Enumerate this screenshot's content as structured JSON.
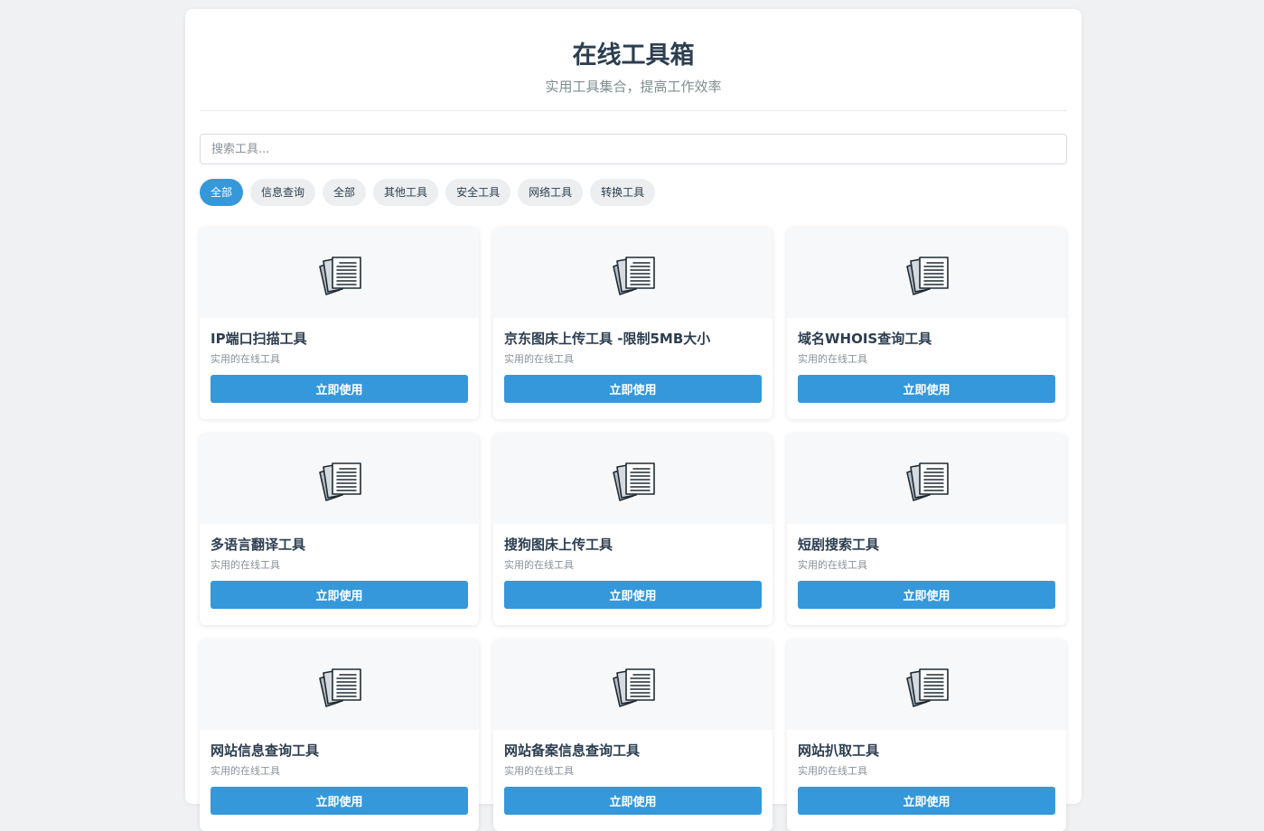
{
  "header": {
    "title": "在线工具箱",
    "subtitle": "实用工具集合，提高工作效率"
  },
  "search": {
    "placeholder": "搜索工具...",
    "value": ""
  },
  "filters": [
    {
      "label": "全部",
      "active": true
    },
    {
      "label": "信息查询",
      "active": false
    },
    {
      "label": "全部",
      "active": false
    },
    {
      "label": "其他工具",
      "active": false
    },
    {
      "label": "安全工具",
      "active": false
    },
    {
      "label": "网络工具",
      "active": false
    },
    {
      "label": "转换工具",
      "active": false
    }
  ],
  "cards": [
    {
      "title": "IP端口扫描工具",
      "desc": "实用的在线工具",
      "button": "立即使用",
      "icon": "document-stack-icon"
    },
    {
      "title": "京东图床上传工具 -限制5MB大小",
      "desc": "实用的在线工具",
      "button": "立即使用",
      "icon": "document-stack-icon"
    },
    {
      "title": "域名WHOIS查询工具",
      "desc": "实用的在线工具",
      "button": "立即使用",
      "icon": "document-stack-icon"
    },
    {
      "title": "多语言翻译工具",
      "desc": "实用的在线工具",
      "button": "立即使用",
      "icon": "document-stack-icon"
    },
    {
      "title": "搜狗图床上传工具",
      "desc": "实用的在线工具",
      "button": "立即使用",
      "icon": "document-stack-icon"
    },
    {
      "title": "短剧搜索工具",
      "desc": "实用的在线工具",
      "button": "立即使用",
      "icon": "document-stack-icon"
    },
    {
      "title": "网站信息查询工具",
      "desc": "实用的在线工具",
      "button": "立即使用",
      "icon": "document-stack-icon"
    },
    {
      "title": "网站备案信息查询工具",
      "desc": "实用的在线工具",
      "button": "立即使用",
      "icon": "document-stack-icon"
    },
    {
      "title": "网站扒取工具",
      "desc": "实用的在线工具",
      "button": "立即使用",
      "icon": "document-stack-icon"
    }
  ],
  "colors": {
    "accent": "#3498db",
    "text": "#2c3e50",
    "muted": "#7f8c8d",
    "background": "#f0f1f3"
  }
}
